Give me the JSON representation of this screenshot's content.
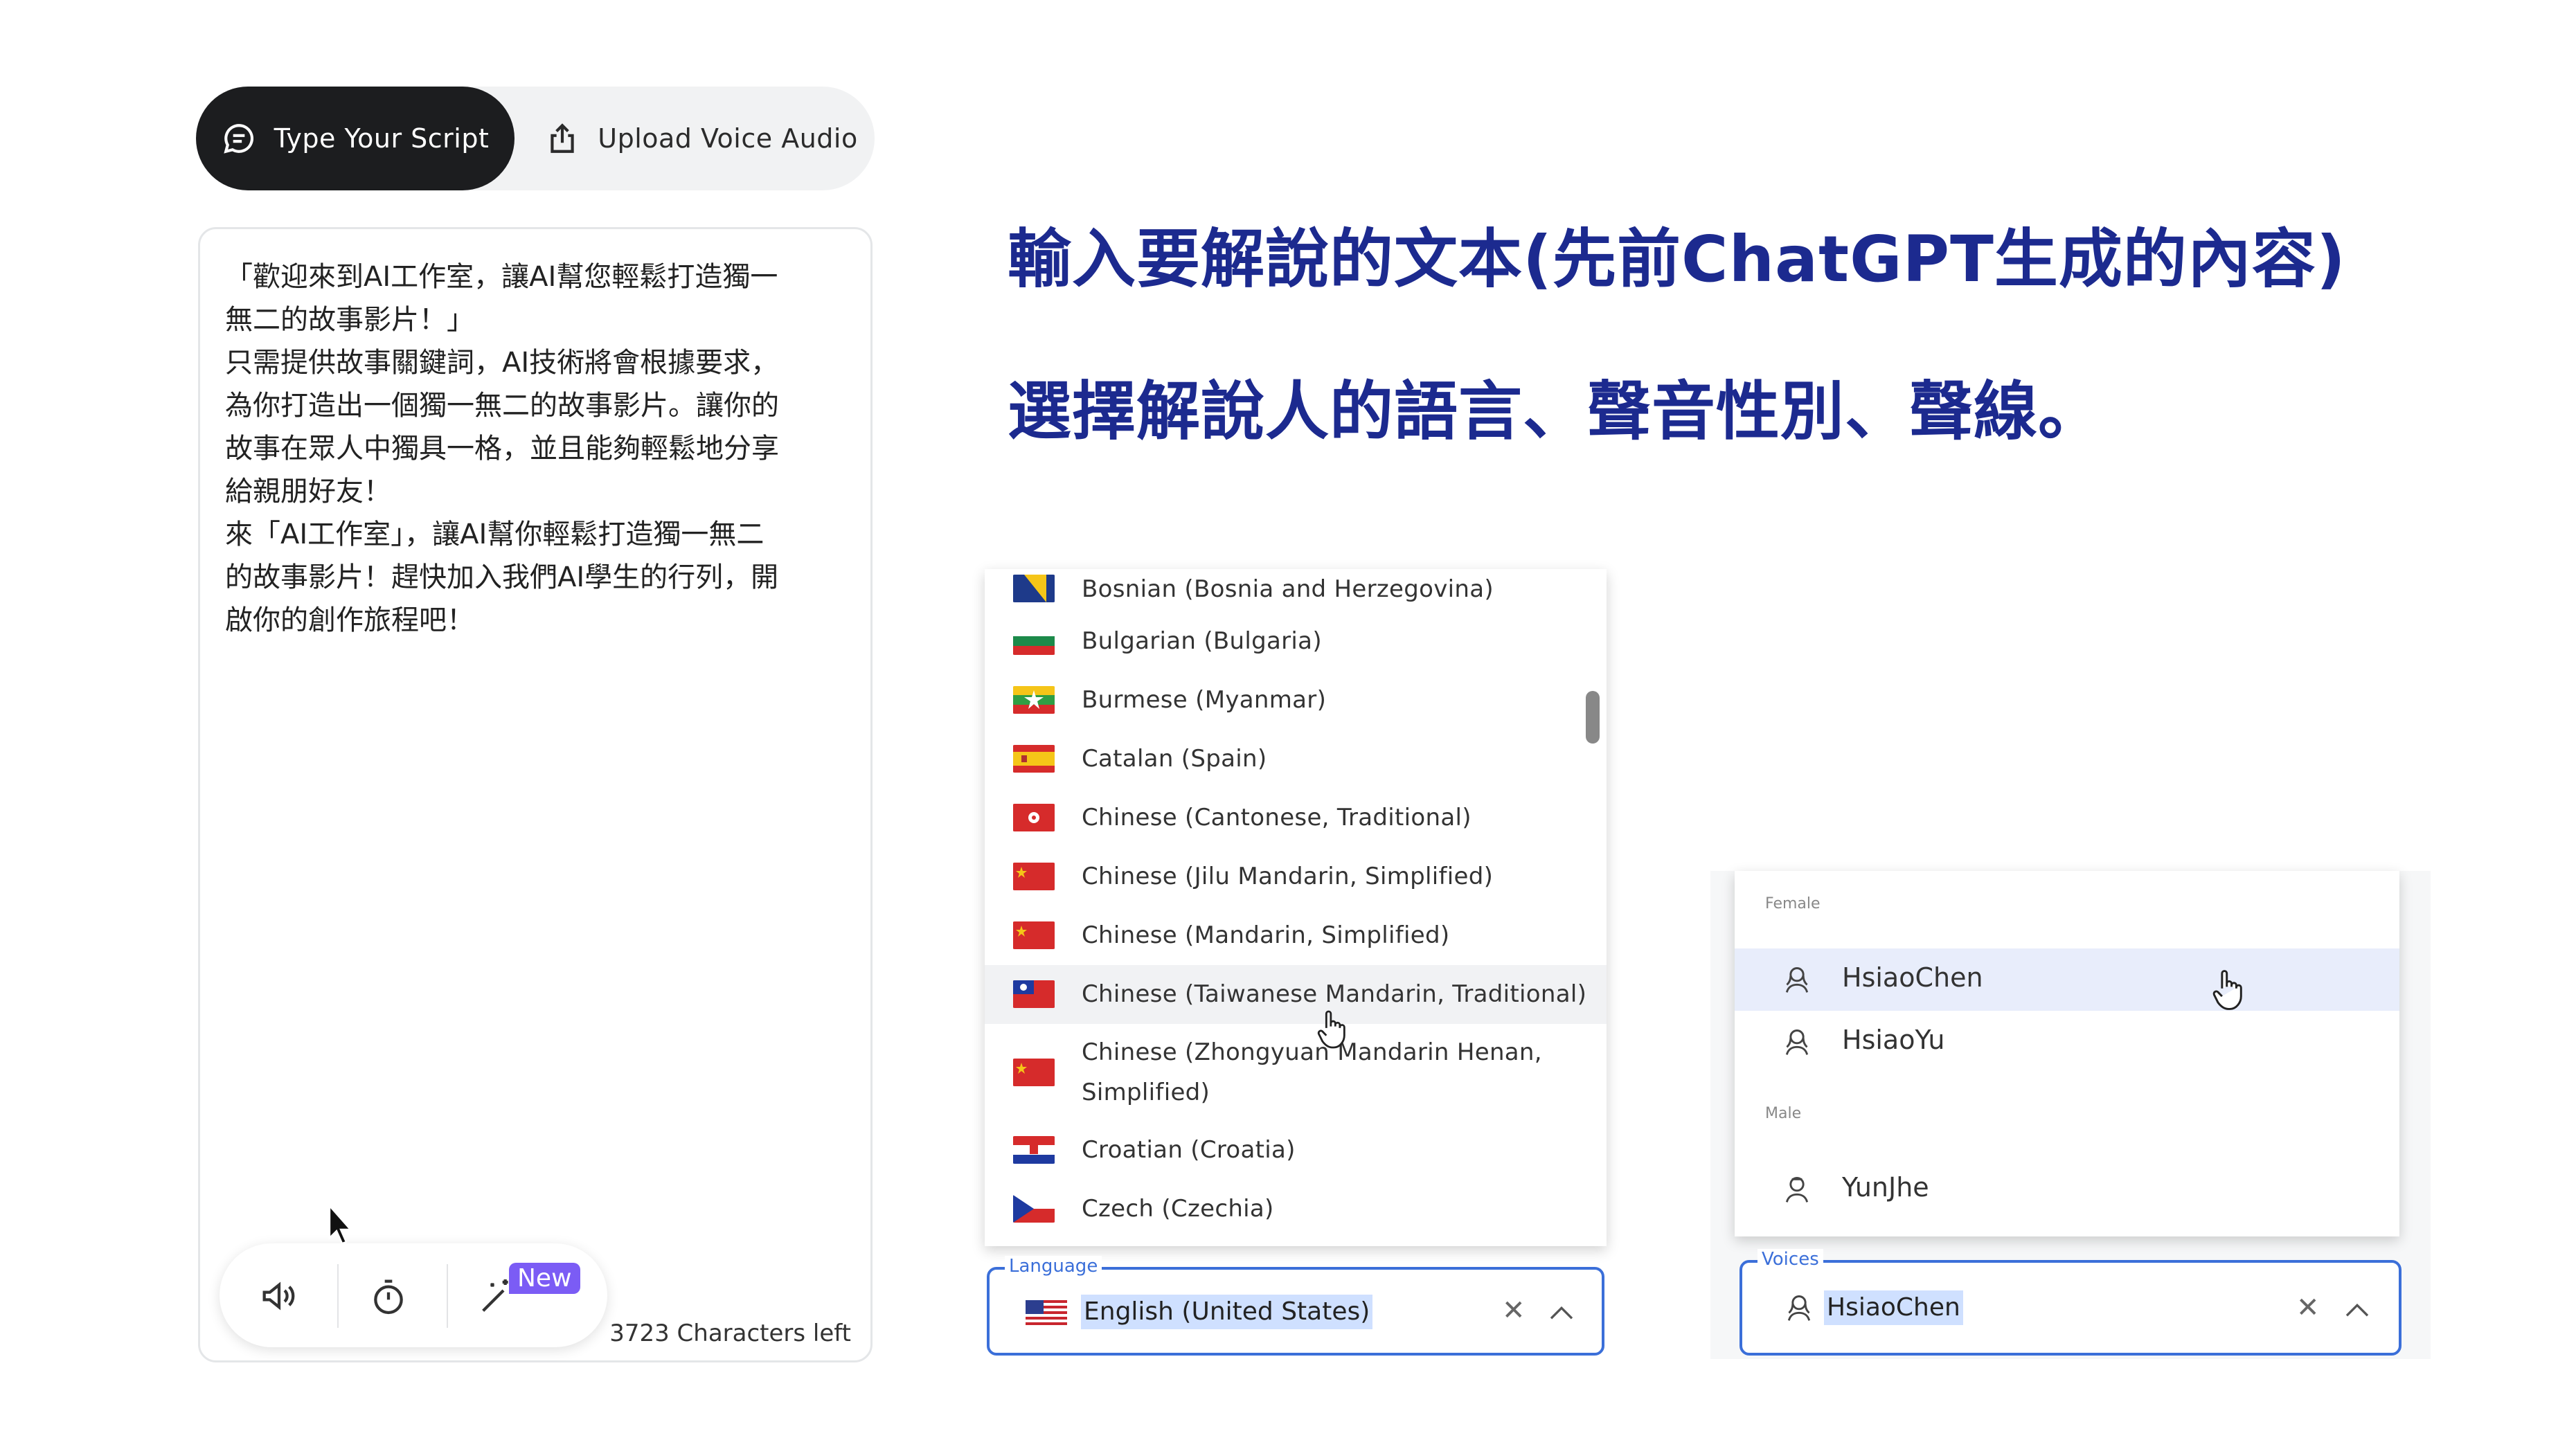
{
  "tabs": {
    "script_label": "Type Your Script",
    "upload_label": "Upload Voice Audio"
  },
  "script": {
    "text": "「歡迎來到AI工作室，讓AI幫您輕鬆打造獨一\n無二的故事影片！」\n只需提供故事關鍵詞，AI技術將會根據要求，\n為你打造出一個獨一無二的故事影片。讓你的\n故事在眾人中獨具一格，並且能夠輕鬆地分享\n給親朋好友！\n來「AI工作室」，讓AI幫你輕鬆打造獨一無二\n的故事影片！趕快加入我們AI學生的行列，開\n啟你的創作旅程吧！",
    "new_badge": "New",
    "chars_left": "3723 Characters left"
  },
  "headlines": {
    "line1": "輸入要解說的文本(先前ChatGPT生成的內容)",
    "line2": "選擇解說人的語言、聲音性別、聲線。"
  },
  "language_dropdown": {
    "options": [
      {
        "label": "Bosnian (Bosnia and Herzegovina)",
        "flag": "bosnia-flag"
      },
      {
        "label": "Bulgarian (Bulgaria)",
        "flag": "bulgaria-flag"
      },
      {
        "label": "Burmese (Myanmar)",
        "flag": "myanmar-flag"
      },
      {
        "label": "Catalan (Spain)",
        "flag": "spain-flag"
      },
      {
        "label": "Chinese (Cantonese, Traditional)",
        "flag": "hong-kong-flag"
      },
      {
        "label": "Chinese (Jilu Mandarin, Simplified)",
        "flag": "china-flag"
      },
      {
        "label": "Chinese (Mandarin, Simplified)",
        "flag": "china-flag"
      },
      {
        "label": "Chinese (Taiwanese Mandarin, Traditional)",
        "flag": "taiwan-flag"
      },
      {
        "label": "Chinese (Zhongyuan Mandarin Henan, Simplified)",
        "flag": "china-flag"
      },
      {
        "label": "Croatian (Croatia)",
        "flag": "croatia-flag"
      },
      {
        "label": "Czech (Czechia)",
        "flag": "czechia-flag"
      }
    ],
    "highlighted": "Chinese (Taiwanese Mandarin, Traditional)",
    "field_label": "Language",
    "field_value": "English (United States)",
    "field_flag": "us-flag"
  },
  "voices_dropdown": {
    "group_female": "Female",
    "group_male": "Male",
    "female": [
      "HsiaoChen",
      "HsiaoYu"
    ],
    "male": [
      "YunJhe"
    ],
    "highlighted": "HsiaoChen",
    "field_label": "Voices",
    "field_value": "HsiaoChen"
  },
  "colors": {
    "headline": "#1c2a8f",
    "accent": "#3b6fd9",
    "tab_active_bg": "#1c1d1f",
    "new_badge": "#7b5cf5"
  }
}
